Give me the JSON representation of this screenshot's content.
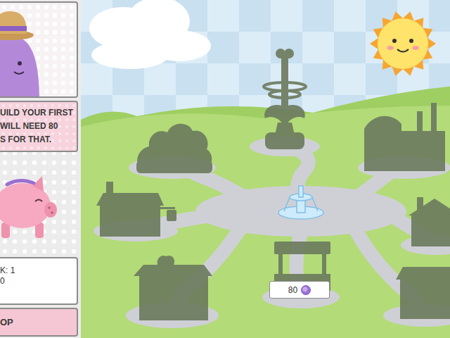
{
  "sidebar": {
    "guide": {
      "speech": [
        "UILD YOUR FIRST",
        "WILL NEED 80",
        "S FOR THAT."
      ]
    },
    "bank": {
      "stats": [
        "K: 1",
        "0"
      ]
    },
    "shop_button": "OP"
  },
  "map": {
    "buildings": [
      {
        "kind": "grove",
        "locked": true
      },
      {
        "kind": "tower",
        "locked": true
      },
      {
        "kind": "factory",
        "locked": true
      },
      {
        "kind": "house",
        "locked": true
      },
      {
        "kind": "cottage",
        "locked": true
      },
      {
        "kind": "shed",
        "locked": true
      },
      {
        "kind": "stall",
        "locked": true
      },
      {
        "kind": "barn",
        "locked": true
      }
    ],
    "fountain": {
      "locked": false
    },
    "price_tag": {
      "amount": "80"
    }
  }
}
